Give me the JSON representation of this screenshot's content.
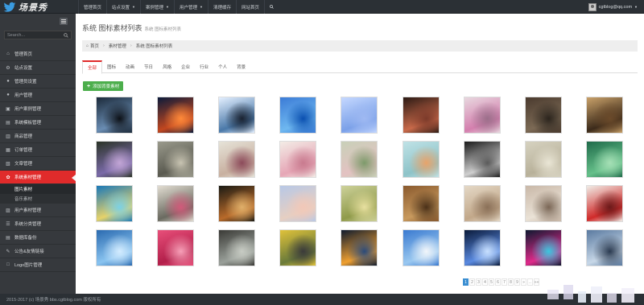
{
  "brand": {
    "logo_text": "场景秀"
  },
  "topnav": [
    {
      "label": "管理首页",
      "caret": false
    },
    {
      "label": "站点设置",
      "caret": true
    },
    {
      "label": "案例管理",
      "caret": true
    },
    {
      "label": "用户管理",
      "caret": true
    },
    {
      "label": "清理缓存",
      "caret": false
    },
    {
      "label": "网站首页",
      "caret": false
    }
  ],
  "user": {
    "email": "cgtblog@qq.com"
  },
  "sidebar": {
    "search_placeholder": "Search...",
    "items": [
      {
        "label": "管理首页",
        "icon": "home-icon",
        "glyph": "⌂"
      },
      {
        "label": "站点设置",
        "icon": "gears-icon",
        "glyph": "⚙"
      },
      {
        "label": "管理员设置",
        "icon": "user-icon",
        "glyph": "●"
      },
      {
        "label": "用户管理",
        "icon": "user-icon",
        "glyph": "●"
      },
      {
        "label": "用户案例管理",
        "icon": "image-icon",
        "glyph": "▣"
      },
      {
        "label": "系统模板管理",
        "icon": "template-icon",
        "glyph": "▤"
      },
      {
        "label": "商品管理",
        "icon": "box-icon",
        "glyph": "▥"
      },
      {
        "label": "订单管理",
        "icon": "order-icon",
        "glyph": "▦"
      },
      {
        "label": "文章管理",
        "icon": "article-icon",
        "glyph": "▧"
      },
      {
        "label": "系统素材管理",
        "icon": "material-icon",
        "glyph": "✿",
        "active": true,
        "children": [
          {
            "label": "图片素材",
            "current": true
          },
          {
            "label": "音乐素材"
          }
        ]
      },
      {
        "label": "用户素材管理",
        "icon": "folder-icon",
        "glyph": "▨"
      },
      {
        "label": "系统分类管理",
        "icon": "category-icon",
        "glyph": "☰"
      },
      {
        "label": "数据库备份",
        "icon": "database-icon",
        "glyph": "▤"
      },
      {
        "label": "公告&友情链接",
        "icon": "link-icon",
        "glyph": "✎"
      },
      {
        "label": "Logo图片管理",
        "icon": "logo-icon",
        "glyph": "□"
      }
    ]
  },
  "page": {
    "title": "系统 图标素材列表",
    "subtitle": "系统 图标素材列表"
  },
  "breadcrumb": [
    "首页",
    "素材管理",
    "系统 图标素材列表"
  ],
  "tabs": [
    "全部",
    "图标",
    "动画",
    "节日",
    "风格",
    "企业",
    "行业",
    "个人",
    "背景"
  ],
  "add_button": {
    "label": "添加背景素材"
  },
  "thumbnails": [
    {
      "colors": [
        "#1b2a3a",
        "#6a8db3",
        "#0c1016"
      ]
    },
    {
      "colors": [
        "#0a1a3a",
        "#c2471f",
        "#ff8a3a"
      ]
    },
    {
      "colors": [
        "#e4f0ff",
        "#4a78a8",
        "#1a2230"
      ]
    },
    {
      "colors": [
        "#3b7bd6",
        "#6fb8f0",
        "#0a4fb0"
      ]
    },
    {
      "colors": [
        "#c5d8ff",
        "#7aa0e8",
        "#9fb9f2"
      ]
    },
    {
      "colors": [
        "#2b1a14",
        "#c96a4a",
        "#7b3a2a"
      ]
    },
    {
      "colors": [
        "#e8d8df",
        "#d47fae",
        "#9b6f8a"
      ]
    },
    {
      "colors": [
        "#4a3a2e",
        "#7c6a55",
        "#2b241d"
      ]
    },
    {
      "colors": [
        "#caa26a",
        "#3b2a1a",
        "#6b4a2a"
      ]
    },
    {
      "colors": [
        "#2a3326",
        "#7a6aa8",
        "#c3a6d6"
      ]
    },
    {
      "colors": [
        "#9a9a8c",
        "#5a5a50",
        "#c8c4b2"
      ]
    },
    {
      "colors": [
        "#e6e3d8",
        "#c8b0a0",
        "#8c4a5a"
      ]
    },
    {
      "colors": [
        "#f3ece6",
        "#e6a6b6",
        "#c87a8e"
      ]
    },
    {
      "colors": [
        "#c8d0b8",
        "#e3c2c2",
        "#7d9a6a"
      ]
    },
    {
      "colors": [
        "#bfe2e6",
        "#8ec3c8",
        "#e8a36a"
      ]
    },
    {
      "colors": [
        "#1a1a1a",
        "#d0d0d0",
        "#5a5a5a"
      ]
    },
    {
      "colors": [
        "#d6d2c0",
        "#b8b19a",
        "#eae6d6"
      ]
    },
    {
      "colors": [
        "#1f6b4a",
        "#66c08a",
        "#a6e0b6"
      ]
    },
    {
      "colors": [
        "#1a78b8",
        "#e6d26a",
        "#7ad0e6"
      ]
    },
    {
      "colors": [
        "#e2ddd2",
        "#6a6a60",
        "#d25a7a"
      ]
    },
    {
      "colors": [
        "#1a1a14",
        "#b86a2a",
        "#e0b06a"
      ]
    },
    {
      "colors": [
        "#b8c8e6",
        "#e6cfc2",
        "#f2c8b8"
      ]
    },
    {
      "colors": [
        "#cdd19a",
        "#8f9a4a",
        "#e8e0a0"
      ]
    },
    {
      "colors": [
        "#8a5a2e",
        "#c89a5e",
        "#4a3018"
      ]
    },
    {
      "colors": [
        "#e4d8c6",
        "#c2a88a",
        "#8a7058"
      ]
    },
    {
      "colors": [
        "#c9b8a8",
        "#eae2d6",
        "#7a6655"
      ]
    },
    {
      "colors": [
        "#f0ece6",
        "#d02a2a",
        "#6b1a1a"
      ]
    },
    {
      "colors": [
        "#2a6ab0",
        "#8ac4f0",
        "#d4ecff"
      ]
    },
    {
      "colors": [
        "#e84f7a",
        "#b21f4a",
        "#f7a0b8"
      ]
    },
    {
      "colors": [
        "#3a3a36",
        "#9aa09a",
        "#c8ccc4"
      ]
    },
    {
      "colors": [
        "#e0c23a",
        "#6a7a3a",
        "#3a3a3a"
      ]
    },
    {
      "colors": [
        "#0e1a2e",
        "#f0a030",
        "#2a4a7a"
      ]
    },
    {
      "colors": [
        "#3a7ad0",
        "#9ac8f0",
        "#f2f6fa"
      ]
    },
    {
      "colors": [
        "#0a1a3a",
        "#5a8ae0",
        "#c8e0ff"
      ]
    },
    {
      "colors": [
        "#0e1830",
        "#e02a8a",
        "#3ac8e0"
      ]
    },
    {
      "colors": [
        "#5a7aa0",
        "#c8d8e8",
        "#2a3a50"
      ]
    }
  ],
  "pagination": [
    "1",
    "2",
    "3",
    "4",
    "5",
    "6",
    "7",
    "8",
    "9",
    "»",
    "..",
    "»»"
  ],
  "footer": {
    "text": "2015-2017 (c) 场景秀 bbs.cgtblog.com 版权所有"
  }
}
